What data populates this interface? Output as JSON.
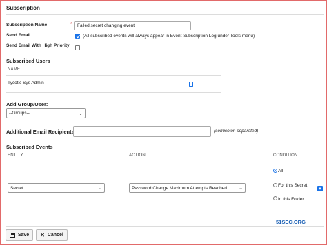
{
  "page": {
    "title": "Subscription"
  },
  "form": {
    "subscription_name_label": "Subscription Name",
    "required_marker": "*",
    "subscription_name_value": "Failed secret changing event",
    "send_email_label": "Send Email",
    "send_email_checked": true,
    "send_email_note": "(All subscribed events will always appear in Event Subscription Log under Tools menu)",
    "high_priority_label": "Send Email With High Priority",
    "high_priority_checked": false
  },
  "subscribed_users": {
    "title": "Subscribed Users",
    "column_name": "NAME",
    "rows": [
      {
        "name": "Tycotic Sys Admin"
      }
    ]
  },
  "add_group_user": {
    "label": "Add Group/User:",
    "selected": "--Groups--"
  },
  "additional_recipients": {
    "label": "Additional Email Recipients",
    "value": "",
    "hint": "(semicolon separated)"
  },
  "subscribed_events": {
    "title": "Subscribed Events",
    "columns": {
      "entity": "ENTITY",
      "action": "ACTION",
      "condition": "CONDITION"
    },
    "row": {
      "entity": "Secret",
      "action": "Password Change Maximum Attempts Reached",
      "conditions": [
        {
          "label": "All",
          "checked": true
        },
        {
          "label": "For this Secret",
          "checked": false
        },
        {
          "label": "In this Folder",
          "checked": false
        }
      ]
    }
  },
  "buttons": {
    "save": "Save",
    "cancel": "Cancel"
  },
  "watermark": "51SEC.ORG",
  "colors": {
    "accent": "#1a73e8",
    "frame": "#e26a6a"
  }
}
